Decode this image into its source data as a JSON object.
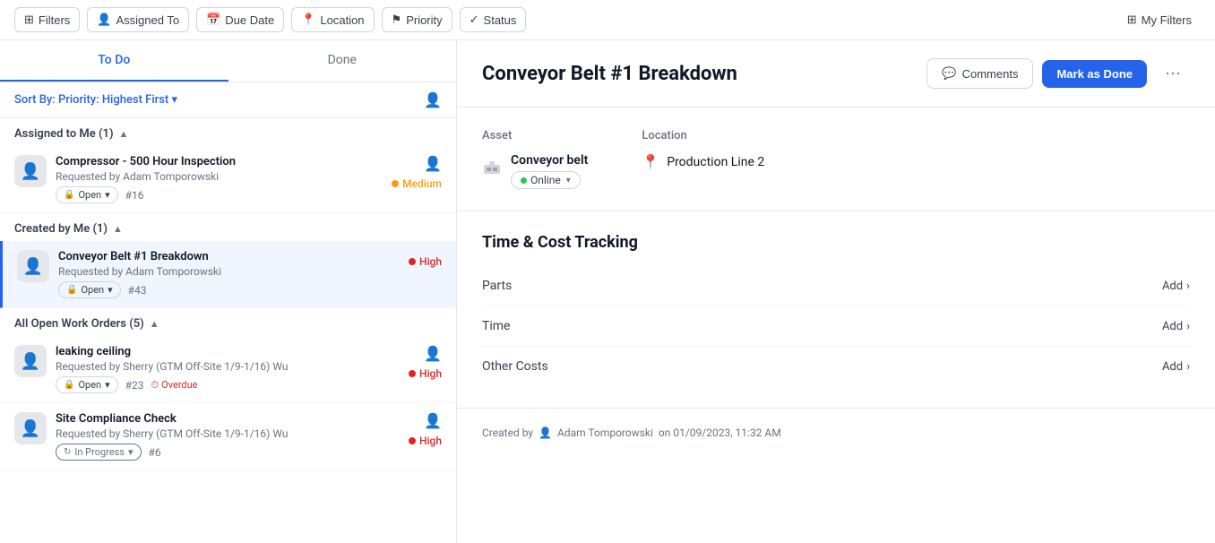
{
  "filterBar": {
    "filters_label": "Filters",
    "assigned_to_label": "Assigned To",
    "due_date_label": "Due Date",
    "location_label": "Location",
    "priority_label": "Priority",
    "status_label": "Status",
    "my_filters_label": "My Filters"
  },
  "tabs": {
    "todo_label": "To Do",
    "done_label": "Done"
  },
  "sortBar": {
    "prefix": "Sort By:",
    "sort_key": "Priority",
    "sort_value": "Highest First"
  },
  "sections": [
    {
      "id": "assigned-to-me",
      "label": "Assigned to Me (1)",
      "items": [
        {
          "id": "item-1",
          "title": "Compressor - 500 Hour Inspection",
          "requester": "Requested by Adam Tomporowski",
          "number": "#16",
          "status": "Open",
          "priority": "Medium",
          "priority_type": "medium",
          "has_assignee": true,
          "overdue": false,
          "in_progress": false
        }
      ]
    },
    {
      "id": "created-by-me",
      "label": "Created by Me (1)",
      "items": [
        {
          "id": "item-2",
          "title": "Conveyor Belt #1 Breakdown",
          "requester": "Requested by Adam Tomporowski",
          "number": "#43",
          "status": "Open",
          "priority": "High",
          "priority_type": "high",
          "has_assignee": false,
          "overdue": false,
          "in_progress": false,
          "active": true
        }
      ]
    },
    {
      "id": "all-open-work-orders",
      "label": "All Open Work Orders (5)",
      "items": [
        {
          "id": "item-3",
          "title": "leaking ceiling",
          "requester": "Requested by Sherry (GTM Off-Site 1/9-1/16) Wu",
          "number": "#23",
          "status": "Open",
          "priority": "High",
          "priority_type": "high",
          "has_assignee": true,
          "overdue": true,
          "in_progress": false
        },
        {
          "id": "item-4",
          "title": "Site Compliance Check",
          "requester": "Requested by Sherry (GTM Off-Site 1/9-1/16) Wu",
          "number": "#6",
          "status": "In Progress",
          "priority": "High",
          "priority_type": "high",
          "has_assignee": true,
          "overdue": false,
          "in_progress": true
        }
      ]
    }
  ],
  "detail": {
    "title": "Conveyor Belt #1 Breakdown",
    "comments_label": "Comments",
    "mark_done_label": "Mark as Done",
    "asset_label": "Asset",
    "location_label": "Location",
    "asset_name": "Conveyor belt",
    "asset_status": "Online",
    "location_name": "Production Line 2",
    "time_cost_title": "Time & Cost Tracking",
    "parts_label": "Parts",
    "time_label": "Time",
    "other_costs_label": "Other Costs",
    "add_label": "Add",
    "created_by_prefix": "Created by",
    "created_by_user": "Adam Tomporowski",
    "created_date": "on 01/09/2023, 11:32 AM"
  },
  "icons": {
    "filter": "⊞",
    "assigned_to": "👤",
    "due_date": "📅",
    "location": "📍",
    "priority": "⚑",
    "status": "✓",
    "my_filters": "⊞",
    "settings": "⚙",
    "person": "👤",
    "asset": "⬛",
    "pin": "📍",
    "clock": "⏱",
    "chevron_down": "▾",
    "chevron_up": "▴",
    "lock": "🔒",
    "more": "⋯",
    "comment": "💬",
    "add_arrow": "›",
    "user_small": "👤"
  }
}
